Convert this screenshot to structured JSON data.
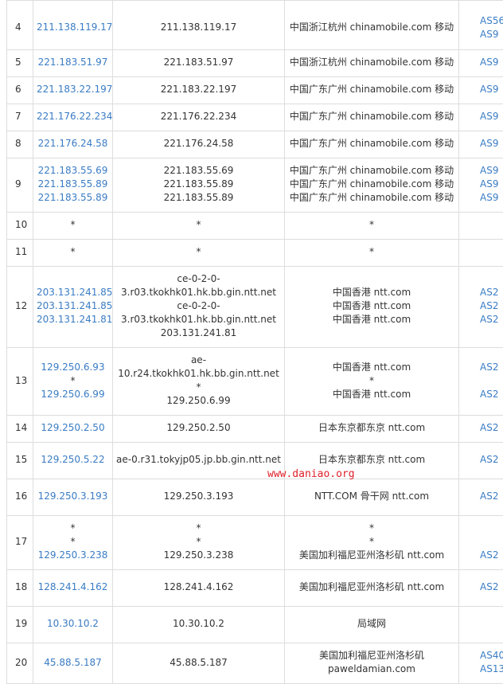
{
  "watermark": "www.daniao.org",
  "rows": [
    {
      "hop": "4",
      "ips": [
        "211.138.119.17"
      ],
      "hosts": [
        "211.138.119.17"
      ],
      "locs": [
        "中国浙江杭州 chinamobile.com 移动"
      ],
      "asn": [
        "AS56",
        "AS9"
      ]
    },
    {
      "hop": "5",
      "ips": [
        "221.183.51.97"
      ],
      "hosts": [
        "221.183.51.97"
      ],
      "locs": [
        "中国浙江杭州 chinamobile.com 移动"
      ],
      "asn": [
        "AS9"
      ]
    },
    {
      "hop": "6",
      "ips": [
        "221.183.22.197"
      ],
      "hosts": [
        "221.183.22.197"
      ],
      "locs": [
        "中国广东广州 chinamobile.com 移动"
      ],
      "asn": [
        "AS9"
      ]
    },
    {
      "hop": "7",
      "ips": [
        "221.176.22.234"
      ],
      "hosts": [
        "221.176.22.234"
      ],
      "locs": [
        "中国广东广州 chinamobile.com 移动"
      ],
      "asn": [
        "AS9"
      ]
    },
    {
      "hop": "8",
      "ips": [
        "221.176.24.58"
      ],
      "hosts": [
        "221.176.24.58"
      ],
      "locs": [
        "中国广东广州 chinamobile.com 移动"
      ],
      "asn": [
        "AS9"
      ]
    },
    {
      "hop": "9",
      "ips": [
        "221.183.55.69",
        "221.183.55.89",
        "221.183.55.89"
      ],
      "hosts": [
        "221.183.55.69",
        "221.183.55.89",
        "221.183.55.89"
      ],
      "locs": [
        "中国广东广州 chinamobile.com 移动",
        "中国广东广州 chinamobile.com 移动",
        "中国广东广州 chinamobile.com 移动"
      ],
      "asn": [
        "AS9",
        "AS9",
        "AS9"
      ]
    },
    {
      "hop": "10",
      "ips": [
        "*"
      ],
      "hosts": [
        "*"
      ],
      "locs": [
        "*"
      ],
      "asn": []
    },
    {
      "hop": "11",
      "ips": [
        "*"
      ],
      "hosts": [
        "*"
      ],
      "locs": [
        "*"
      ],
      "asn": []
    },
    {
      "hop": "12",
      "ips": [
        "203.131.241.85",
        "203.131.241.85",
        "203.131.241.81"
      ],
      "hosts": [
        "ce-0-2-0-",
        "3.r03.tkokhk01.hk.bb.gin.ntt.net",
        "ce-0-2-0-",
        "3.r03.tkokhk01.hk.bb.gin.ntt.net",
        "203.131.241.81"
      ],
      "locs": [
        "中国香港 ntt.com",
        "中国香港 ntt.com",
        "中国香港 ntt.com"
      ],
      "asn": [
        "AS2",
        "AS2",
        "AS2"
      ]
    },
    {
      "hop": "13",
      "ips": [
        "129.250.6.93",
        "*",
        "129.250.6.99"
      ],
      "hosts": [
        "ae-",
        "10.r24.tkokhk01.hk.bb.gin.ntt.net",
        "*",
        "129.250.6.99"
      ],
      "locs": [
        "中国香港 ntt.com",
        "*",
        "中国香港 ntt.com"
      ],
      "asn": [
        "AS2",
        "",
        "AS2"
      ]
    },
    {
      "hop": "14",
      "ips": [
        "129.250.2.50"
      ],
      "hosts": [
        "129.250.2.50"
      ],
      "locs": [
        "日本东京都东京 ntt.com"
      ],
      "asn": [
        "AS2"
      ]
    },
    {
      "hop": "15",
      "ips": [
        "129.250.5.22"
      ],
      "hosts": [
        "ae-0.r31.tokyjp05.jp.bb.gin.ntt.net"
      ],
      "locs": [
        "日本东京都东京 ntt.com"
      ],
      "asn": [
        "AS2"
      ]
    },
    {
      "hop": "16",
      "ips": [
        "129.250.3.193"
      ],
      "hosts": [
        "129.250.3.193"
      ],
      "locs": [
        "NTT.COM 骨干网 ntt.com"
      ],
      "asn": [
        "AS2"
      ]
    },
    {
      "hop": "17",
      "ips": [
        "*",
        "*",
        "129.250.3.238"
      ],
      "hosts": [
        "*",
        "*",
        "129.250.3.238"
      ],
      "locs": [
        "*",
        "*",
        "美国加利福尼亚州洛杉矶 ntt.com"
      ],
      "asn": [
        "",
        "",
        "AS2"
      ]
    },
    {
      "hop": "18",
      "ips": [
        "128.241.4.162"
      ],
      "hosts": [
        "128.241.4.162"
      ],
      "locs": [
        "美国加利福尼亚州洛杉矶 ntt.com"
      ],
      "asn": [
        "AS2"
      ]
    },
    {
      "hop": "19",
      "ips": [
        "10.30.10.2"
      ],
      "hosts": [
        "10.30.10.2"
      ],
      "locs": [
        "局域网"
      ],
      "asn": []
    },
    {
      "hop": "20",
      "ips": [
        "45.88.5.187"
      ],
      "hosts": [
        "45.88.5.187"
      ],
      "locs": [
        "美国加利福尼亚州洛杉矶",
        "paweldamian.com"
      ],
      "asn": [
        "AS40",
        "AS13"
      ]
    }
  ]
}
